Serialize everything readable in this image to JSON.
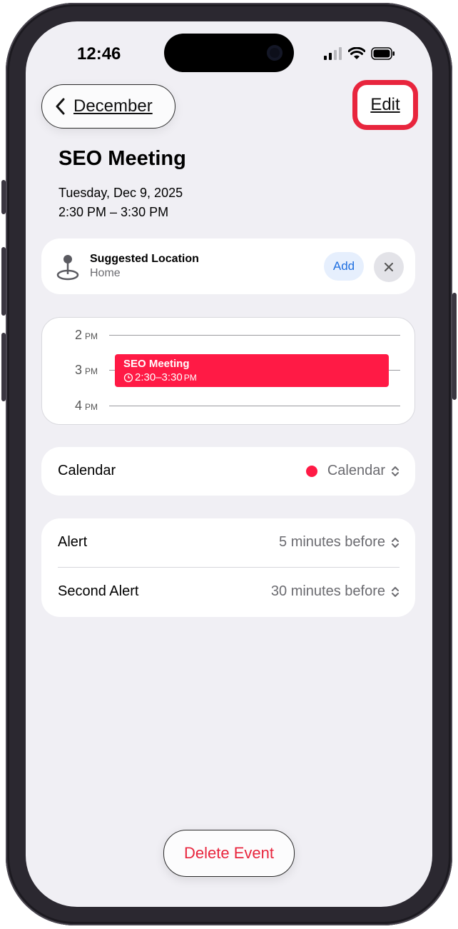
{
  "status": {
    "time": "12:46"
  },
  "nav": {
    "back_label": "December",
    "edit_label": "Edit"
  },
  "event": {
    "title": "SEO Meeting",
    "date": "Tuesday, Dec 9, 2025",
    "time_range": "2:30 PM – 3:30 PM"
  },
  "location": {
    "title": "Suggested Location",
    "subtitle": "Home",
    "add_label": "Add",
    "icons": {
      "pin": "map-pin-icon",
      "dismiss": "close-icon"
    }
  },
  "timeline": {
    "hours": [
      {
        "num": "2",
        "ampm": "PM"
      },
      {
        "num": "3",
        "ampm": "PM"
      },
      {
        "num": "4",
        "ampm": "PM"
      }
    ],
    "event_name": "SEO Meeting",
    "event_time": "2:30–3:30",
    "event_time_suffix": "PM",
    "event_color": "#ff1a45"
  },
  "calendar": {
    "label": "Calendar",
    "value": "Calendar",
    "dot_color": "#ff1a45"
  },
  "alerts": [
    {
      "label": "Alert",
      "value": "5 minutes before"
    },
    {
      "label": "Second Alert",
      "value": "30 minutes before"
    }
  ],
  "delete_label": "Delete Event",
  "colors": {
    "accent_red": "#e8253d",
    "link_blue": "#1f6fe0",
    "background": "#f0eff4"
  }
}
